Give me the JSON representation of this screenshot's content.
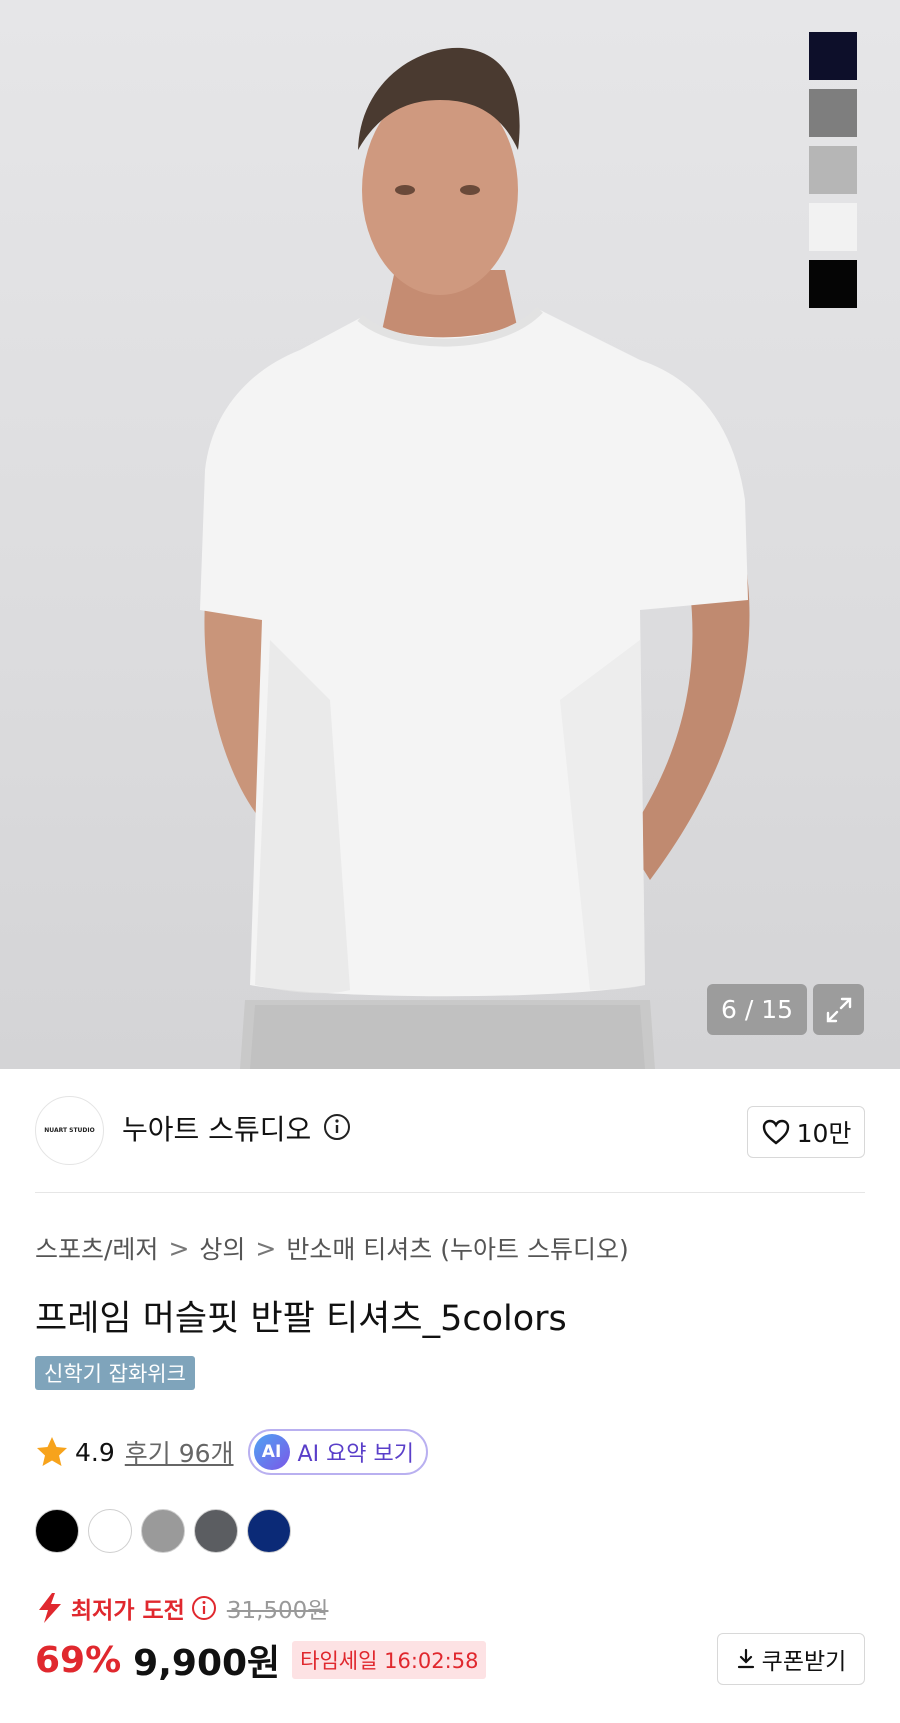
{
  "hero": {
    "swatch_colors": [
      "#0d0f2a",
      "#7e7e7e",
      "#b6b6b6",
      "#f2f2f2",
      "#050505"
    ],
    "counter": "6 / 15",
    "expand_icon": "expand-icon"
  },
  "store": {
    "logo_text": "NUART STUDIO",
    "name": "누아트 스튜디오",
    "info_icon": "info-icon",
    "likes": "10만",
    "heart_icon": "heart-icon"
  },
  "breadcrumb": {
    "items": [
      "스포츠/레저",
      "상의",
      "반소매 티셔츠 (누아트 스튜디오)"
    ],
    "separator": ">"
  },
  "product": {
    "title": "프레임 머슬핏 반팔 티셔츠_5colors",
    "badge": "신학기 잡화위크"
  },
  "rating": {
    "score": "4.9",
    "reviews": "후기 96개",
    "ai_chip": "AI",
    "ai_label": "AI 요약 보기"
  },
  "color_options": [
    "#000000",
    "#ffffff",
    "#9a9a9a",
    "#5b5d61",
    "#0b2a77"
  ],
  "price": {
    "lowest_label": "최저가 도전",
    "original": "31,500원",
    "discount": "69%",
    "sale": "9,900원",
    "timesale": "타임세일 16:02:58",
    "coupon": "쿠폰받기"
  }
}
